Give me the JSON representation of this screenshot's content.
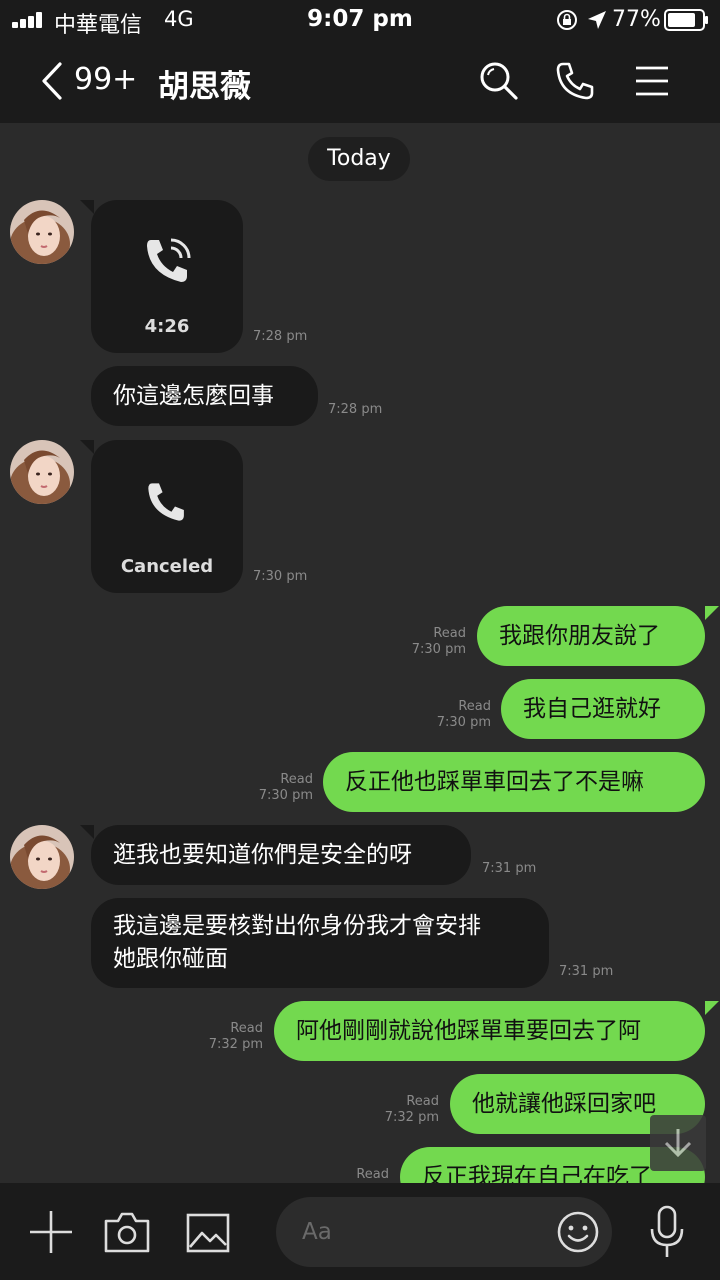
{
  "status_bar": {
    "carrier": "中華電信",
    "network": "4G",
    "time": "9:07 pm",
    "battery": "77%"
  },
  "header": {
    "back_count": "99+",
    "contact_name": "胡思薇"
  },
  "chat": {
    "date_label": "Today",
    "messages": [
      {
        "from": "contact",
        "kind": "call",
        "label": "4:26",
        "time": "7:28 pm"
      },
      {
        "from": "contact",
        "kind": "text",
        "text": "你這邊怎麼回事",
        "time": "7:28 pm"
      },
      {
        "from": "contact",
        "kind": "call",
        "label": "Canceled",
        "time": "7:30 pm"
      },
      {
        "from": "me",
        "text": "我跟你朋友說了",
        "read": "Read",
        "time": "7:30 pm"
      },
      {
        "from": "me",
        "text": "我自己逛就好",
        "read": "Read",
        "time": "7:30 pm"
      },
      {
        "from": "me",
        "text": "反正他也踩單車回去了不是嘛",
        "read": "Read",
        "time": "7:30 pm"
      },
      {
        "from": "contact",
        "kind": "text",
        "text": "逛我也要知道你們是安全的呀",
        "time": "7:31 pm"
      },
      {
        "from": "contact",
        "kind": "text",
        "text_line1": "我這邊是要核對出你身份我才會安排",
        "text_line2": "她跟你碰面",
        "time": "7:31 pm"
      },
      {
        "from": "me",
        "text": "阿他剛剛就說他踩單車要回去了阿",
        "read": "Read",
        "time": "7:32 pm"
      },
      {
        "from": "me",
        "text": "他就讓他踩回家吧",
        "read": "Read",
        "time": "7:32 pm"
      },
      {
        "from": "me",
        "text": "反正我現在自己在吃了",
        "read": "Read",
        "time": ""
      }
    ]
  },
  "input": {
    "placeholder": "Aa"
  },
  "colors": {
    "outgoing_bubble": "#73d94f",
    "incoming_bubble": "#1a1a1a",
    "background": "#2b2b2b"
  },
  "icons": [
    "back-icon",
    "search-icon",
    "phone-icon",
    "menu-icon",
    "plus-icon",
    "camera-icon",
    "image-icon",
    "emoji-icon",
    "mic-icon",
    "scroll-down-icon"
  ]
}
